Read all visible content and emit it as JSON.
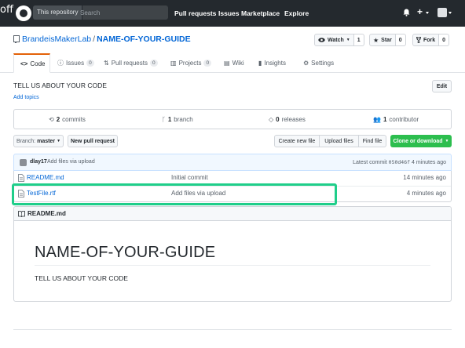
{
  "overlay_text": "off",
  "header": {
    "search_scope": "This repository",
    "search_placeholder": "Search",
    "nav": [
      "Pull requests",
      "Issues",
      "Marketplace",
      "Explore"
    ],
    "icons": [
      "github-logo-icon",
      "bell-icon",
      "plus-icon",
      "avatar-icon"
    ]
  },
  "repo": {
    "owner": "BrandeisMakerLab",
    "separator": "/",
    "name": "NAME-OF-YOUR-GUIDE",
    "watch": {
      "label": "Watch",
      "count": "1"
    },
    "star": {
      "label": "Star",
      "count": "0"
    },
    "fork": {
      "label": "Fork",
      "count": "0"
    }
  },
  "tabs": [
    {
      "label": "Code",
      "count": null,
      "selected": true
    },
    {
      "label": "Issues",
      "count": "0"
    },
    {
      "label": "Pull requests",
      "count": "0"
    },
    {
      "label": "Projects",
      "count": "0"
    },
    {
      "label": "Wiki",
      "count": null
    },
    {
      "label": "Insights",
      "count": null
    },
    {
      "label": "Settings",
      "count": null
    }
  ],
  "description": "TELL US ABOUT YOUR CODE",
  "add_topics": "Add topics",
  "edit_label": "Edit",
  "summary": {
    "commits": {
      "num": "2",
      "label": "commits"
    },
    "branch": {
      "num": "1",
      "label": "branch"
    },
    "releases": {
      "num": "0",
      "label": "releases"
    },
    "contributors": {
      "num": "1",
      "label": "contributor"
    }
  },
  "file_nav": {
    "branch_label": "Branch:",
    "branch_value": "master",
    "new_pr": "New pull request",
    "create_file": "Create new file",
    "upload_files": "Upload files",
    "find_file": "Find file",
    "clone": "Clone or download"
  },
  "latest_commit": {
    "author": "dlay17",
    "message": "Add files via upload",
    "label": "Latest commit",
    "sha": "050d46f",
    "age": "4 minutes ago"
  },
  "files": [
    {
      "name": "README.md",
      "commit": "Initial commit",
      "age": "14 minutes ago"
    },
    {
      "name": "TestFile.rtf",
      "commit": "Add files via upload",
      "age": "4 minutes ago"
    }
  ],
  "readme": {
    "filename": "README.md",
    "heading": "NAME-OF-YOUR-GUIDE",
    "body": "TELL US ABOUT YOUR CODE"
  },
  "colors": {
    "header_bg": "#24292e",
    "link": "#0366d6",
    "tab_accent": "#e36209",
    "clone_green": "#2cbe4e",
    "highlight_box": "#1fce8a"
  }
}
